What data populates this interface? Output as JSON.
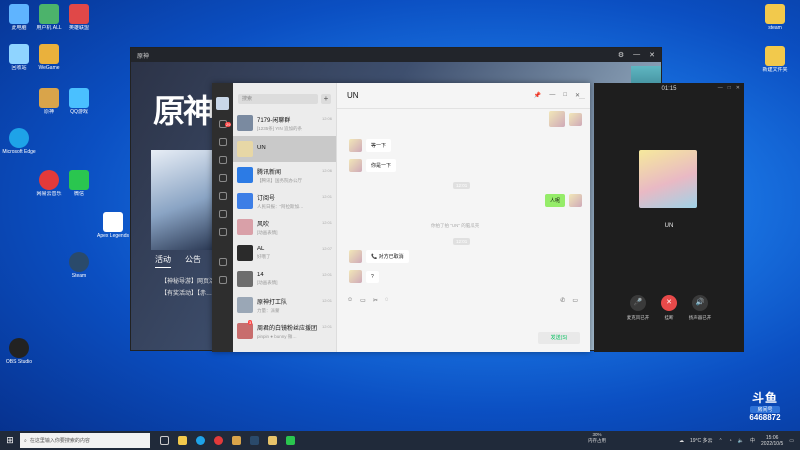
{
  "desktop": {
    "icons": [
      {
        "label": "此电脑",
        "color": "#5fb4ff"
      },
      {
        "label": "用户机 ALL",
        "color": "#4cb36b"
      },
      {
        "label": "英雄联盟",
        "color": "#e04848"
      },
      {
        "label": "回收站",
        "color": "#8fd4ff"
      },
      {
        "label": "WeGame",
        "color": "#eab13c"
      },
      {
        "label": "Microsoft Edge",
        "color": "#1ea3e8"
      },
      {
        "label": "原神",
        "color": "#d9a44a"
      },
      {
        "label": "QQ游戏",
        "color": "#4ac0ff"
      },
      {
        "label": "网易云音乐",
        "color": "#e23a3a"
      },
      {
        "label": "微信",
        "color": "#2ac64f"
      },
      {
        "label": "Steam",
        "color": "#2a4a6b"
      },
      {
        "label": "Apex Legends",
        "color": "#ffffff"
      },
      {
        "label": "OBS Studio",
        "color": "#222222"
      },
      {
        "label": "新建文件夹",
        "color": "#f2c94c"
      },
      {
        "label": "steam",
        "color": "#f2c94c"
      }
    ]
  },
  "game_window": {
    "title": "原神",
    "logo": "原神",
    "tabs": [
      "活动",
      "公告"
    ],
    "news": [
      "【神秘导游】网页活动",
      "【有奖活动】【赤…"
    ]
  },
  "wechat": {
    "nav_badge": "29",
    "search_placeholder": "搜索",
    "chats": [
      {
        "name": "7179-闲聊群",
        "preview": "[1235条] YIN 追加的条",
        "time": "12:06",
        "color": "#7a8aa0",
        "badge": ""
      },
      {
        "name": "UN",
        "preview": "",
        "time": "",
        "color": "#e7d7a6",
        "badge": "",
        "active": true
      },
      {
        "name": "腾讯新闻",
        "preview": "【腾讯】国务院办公厅",
        "time": "12:06",
        "color": "#2c7be5",
        "badge": ""
      },
      {
        "name": "订阅号",
        "preview": "人民日报：“阿拉斯加…",
        "time": "12:01",
        "color": "#3d7ee6",
        "badge": ""
      },
      {
        "name": "风吹",
        "preview": "[动画表情]",
        "time": "12:01",
        "color": "#d9a0a8",
        "badge": ""
      },
      {
        "name": "AL",
        "preview": "好哦了",
        "time": "12:07",
        "color": "#2b2b2b",
        "badge": ""
      },
      {
        "name": "14",
        "preview": "[动画表情]",
        "time": "12:01",
        "color": "#6d6d6d",
        "badge": ""
      },
      {
        "name": "原神打工队",
        "preview": "力量：派蒙",
        "time": "12:01",
        "color": "#9aa7b6",
        "badge": ""
      },
      {
        "name": "周君的白镜粉丝应援团",
        "preview": "pinpin ● bunny 微…",
        "time": "12:01",
        "color": "#c86d6d",
        "badge": "3"
      }
    ],
    "chat_title": "UN",
    "messages": [
      {
        "text": "等一下",
        "side": "left"
      },
      {
        "text": "你是一下",
        "side": "left"
      },
      {
        "text": "人呢",
        "side": "right"
      },
      {
        "text": "对方已取消",
        "side": "left"
      },
      {
        "text": "?",
        "side": "left"
      }
    ],
    "system_notes": [
      "12:01",
      "你拍了拍 \"UN\" 的脑瓜壳",
      "12:01"
    ],
    "send_label": "发送(S)"
  },
  "call": {
    "timer": "01:15",
    "name": "UN",
    "buttons": [
      {
        "label": "麦克风已开",
        "icon": "🎤",
        "color": "#3a3a3a"
      },
      {
        "label": "挂断",
        "icon": "✕",
        "color": "#e84a4a"
      },
      {
        "label": "扬声器已开",
        "icon": "🔊",
        "color": "#3a3a3a"
      }
    ]
  },
  "taskbar": {
    "search_placeholder": "在这里输入你要搜索的内容",
    "cpu_label": "30%",
    "cpu_sub": "内存占用",
    "weather": "19°C 多云",
    "lang": "中",
    "time": "15:06",
    "date": "2022/10/5"
  },
  "overlay": {
    "brand": "斗鱼",
    "tag": "房间号",
    "room_number": "6468872"
  }
}
